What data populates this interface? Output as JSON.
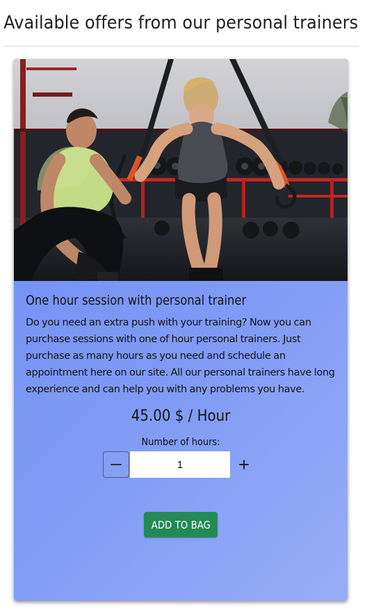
{
  "header": {
    "title": "Available offers from our personal trainers"
  },
  "offer": {
    "title": "One hour session with personal trainer",
    "description": "Do you need an extra push with your training? Now you can purchase sessions with one of hour personal trainers. Just purchase as many hours as you need and schedule an appointment here on our site. All our personal trainers have long experience and can help you with any problems you have.",
    "price": "45.00 $ / Hour",
    "hours_label": "Number of hours:",
    "quantity": "1",
    "add_label": "ADD TO BAG",
    "image_alt": "Personal trainer helping woman exercising with suspension straps"
  },
  "icons": {
    "minus": "minus-icon",
    "plus": "plus-icon"
  },
  "colors": {
    "card_gradient_start": "#6f8df3",
    "card_gradient_end": "#98adf7",
    "add_button": "#238a55"
  }
}
